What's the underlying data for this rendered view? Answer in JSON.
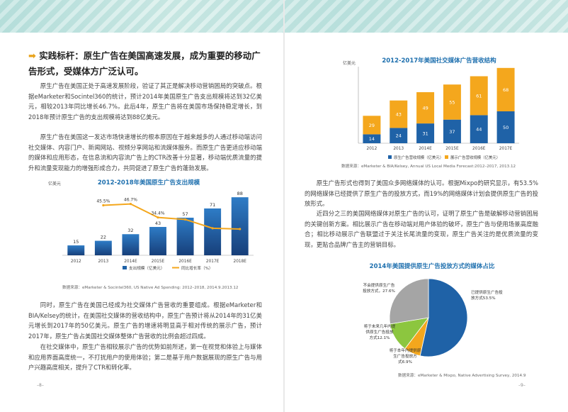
{
  "left": {
    "heading_label": "实践标杆：",
    "heading_text": "原生广告在美国高速发展，成为重要的移动广告形式，受媒体方广泛认可。",
    "para1": "原生广告在美国正处于高速发展阶段，验证了其正是解决移动营销困局的突破点。根据eMarketer和Socintel360的统计，预计2014年美国原生广告支出规模将达到32亿美元，相较2013年同比增长46.7%。此后4年，原生广告将在美国市场保持稳定增长，到2018年预计原生广告的支出规模将达到88亿美元。",
    "para2": "原生广告在美国这一发达市场快速增长的根本原因在于越来越多的人通过移动端访问社交媒体、内容门户、新闻网站、视频分享网站和流媒体服务。而原生广告更适应移动端的媒体和应用形态，在信息流和内容流广告上的CTR改善十分显著，移动端优质流量的提升和流量变现能力的增强形成合力，共同促进了原生广告的蓬勃发展。",
    "para3": "同时，原生广告在美国已经成为社交媒体广告营收的重要组成。根据eMarketer和BIA/Kelsey的统计，在美国社交媒体的营收结构中，原生广告预计将从2014年的31亿美元增长到2017年的50亿美元。原生广告的增速将明显高于相对传统的展示广告，预计2017年，原生广告占美国社交媒体整体广告营收的比例会超过四成。",
    "para4": "在社交媒体中，原生广告相较展示广告的优势如前所述，第一在视觉和体验上与媒体和应用界面高度统一，不打扰用户的使用体验；第二是基于用户数据展现的原生广告与用户兴趣高度相关，提升了CTR和转化率。",
    "page_num": "–8–"
  },
  "right": {
    "para1": "原生广告形式也得到了美国众多网络媒体的认可。根据Mixpo的研究显示，有53.5%的网络媒体已经提供了原生广告的投放方式，而19%的网络媒体计划会提供原生广告的投放形式。",
    "para2": "近四分之三的美国网络媒体对原生广告的认可，证明了原生广告是破解移动营销困局的关键创新方案。相比展示广告在移动端对用户体验的破坏，原生广告与使用场景高度融合；相比移动展示广告联盟过于关注长尾流量的变现，原生广告关注的是优质流量的变现，更贴合品牌广告主的营销目标。",
    "page_num": "–9–"
  },
  "colors": {
    "accent_orange": "#f4a71d",
    "bar_blue": "#1f62a7",
    "teal_banner": "#bfe3e0",
    "gray": "#a5a5a5",
    "green": "#8cc63f"
  },
  "chart_data": [
    {
      "type": "bar",
      "title": "2012-2018年美国原生广告支出规模",
      "ylabel": "亿美元",
      "categories": [
        "2012",
        "2013",
        "2014E",
        "2015E",
        "2016E",
        "2017E",
        "2018E"
      ],
      "series": [
        {
          "name": "支出规模（亿美元）",
          "values": [
            15,
            22,
            32,
            43,
            57,
            71,
            88
          ]
        },
        {
          "name": "同比增长率（%）",
          "values": [
            null,
            45.5,
            46.7,
            34.4,
            32.6,
            24.6,
            23.9
          ]
        }
      ],
      "line_labels": [
        "45.5%",
        "46.7%",
        "34.4%"
      ],
      "ylim": [
        0,
        100
      ],
      "source": "数据来源：eMarketer & Socintel360, US Native Ad Spending: 2012–2018, 2014.9.2013.12"
    },
    {
      "type": "bar",
      "title": "2012-2017年美国社交媒体广告营收结构",
      "ylabel": "亿美元",
      "categories": [
        "2012",
        "2013",
        "2014E",
        "2015E",
        "2016E",
        "2017E"
      ],
      "series": [
        {
          "name": "原生广告营收规模（亿美元）",
          "values": [
            14,
            24,
            31,
            37,
            44,
            50
          ]
        },
        {
          "name": "展示广告营收规模（亿美元）",
          "values": [
            29,
            43,
            49,
            55,
            61,
            68
          ]
        }
      ],
      "stacked": true,
      "ylim": [
        0,
        120
      ],
      "source": "数据来源：eMarketer & BIA/Kelsey, Annual US Local Media Forecast:2012–2017, 2013.12"
    },
    {
      "type": "pie",
      "title": "2014年美国提供原生广告投放方式的媒体占比",
      "slices": [
        {
          "label": "已提供原生广告投放方式53.5%",
          "value": 53.5,
          "color": "#1f62a7"
        },
        {
          "label": "将于本年内提供原生广告投放方式6.9%",
          "value": 6.9,
          "color": "#f4a71d"
        },
        {
          "label": "将于未来几年内提供原生广告投放方式12.1%",
          "value": 12.1,
          "color": "#8cc63f"
        },
        {
          "label": "不会提供原生广告投放方式，27.6%",
          "value": 27.6,
          "color": "#a5a5a5"
        }
      ],
      "source": "数据来源：eMarketer & Mixpo, Native Advertising Survey, 2014.9"
    }
  ]
}
